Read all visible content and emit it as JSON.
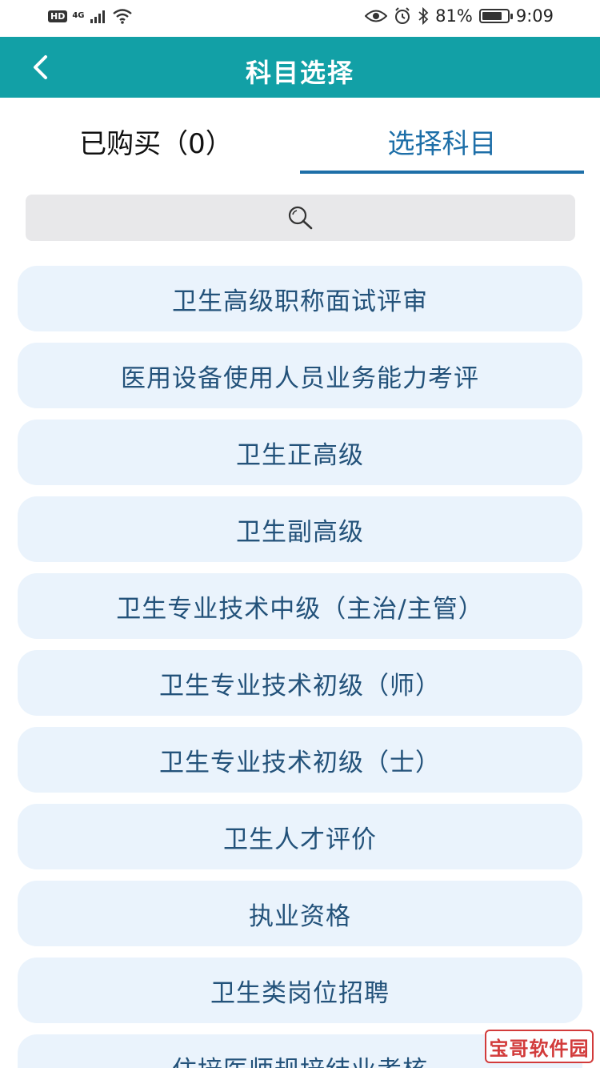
{
  "status_bar": {
    "hd": "HD",
    "network": "4G",
    "battery_percent": "81%",
    "battery_level": 0.81,
    "time": "9:09"
  },
  "header": {
    "title": "科目选择",
    "back_icon": "chevron-left-icon"
  },
  "tabs": [
    {
      "label": "已购买（0）"
    },
    {
      "label": "选择科目"
    }
  ],
  "search": {
    "icon": "search-icon"
  },
  "subjects": [
    {
      "label": "卫生高级职称面试评审"
    },
    {
      "label": "医用设备使用人员业务能力考评"
    },
    {
      "label": "卫生正高级"
    },
    {
      "label": "卫生副高级"
    },
    {
      "label": "卫生专业技术中级（主治/主管）"
    },
    {
      "label": "卫生专业技术初级（师）"
    },
    {
      "label": "卫生专业技术初级（士）"
    },
    {
      "label": "卫生人才评价"
    },
    {
      "label": "执业资格"
    },
    {
      "label": "卫生类岗位招聘"
    },
    {
      "label": "住培医师规培结业考核"
    }
  ],
  "watermark": "宝哥软件园",
  "colors": {
    "header": "#12a0a6",
    "tab_active": "#1e6fa8",
    "item_bg": "#eaf3fc",
    "item_text": "#23527a"
  }
}
